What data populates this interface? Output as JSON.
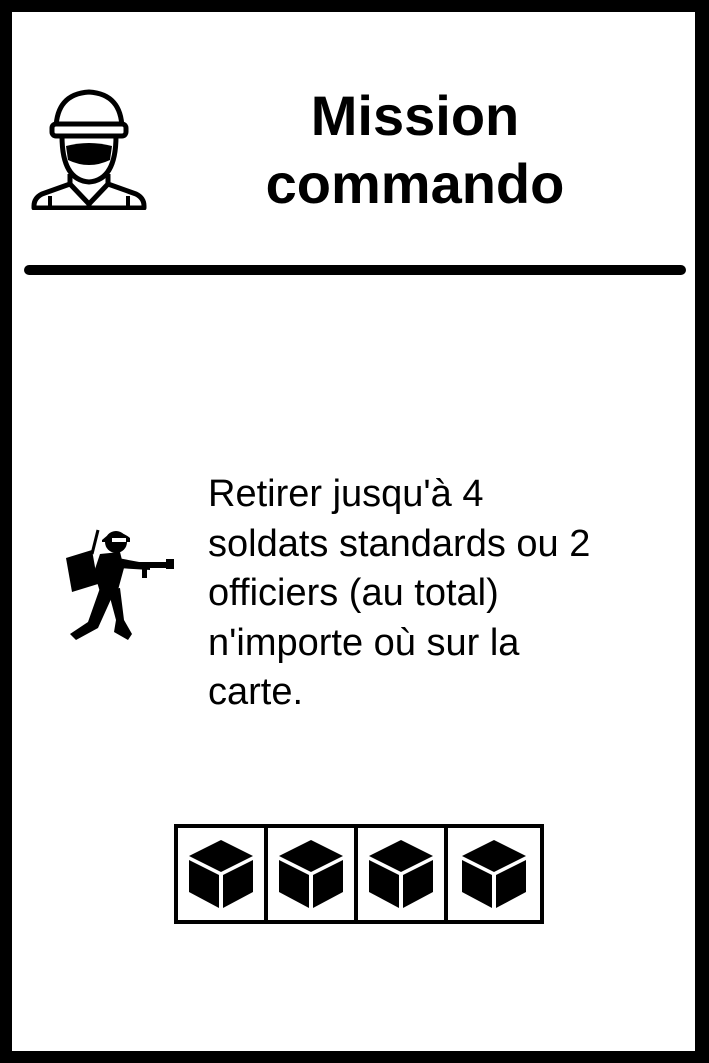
{
  "card": {
    "title_lines": [
      "Mission",
      "commando"
    ],
    "header_icon": "soldier-helmet-icon",
    "action_icon": "soldier-gunner-icon",
    "description_lines": [
      "Retirer jusqu'à 4",
      "soldats standards ou 2",
      "officiers (au total)",
      "n'importe où sur la",
      "carte."
    ],
    "cost": {
      "count": 4,
      "icon": "cube-icon"
    },
    "colors": {
      "ink": "#000000",
      "background": "#ffffff"
    }
  }
}
